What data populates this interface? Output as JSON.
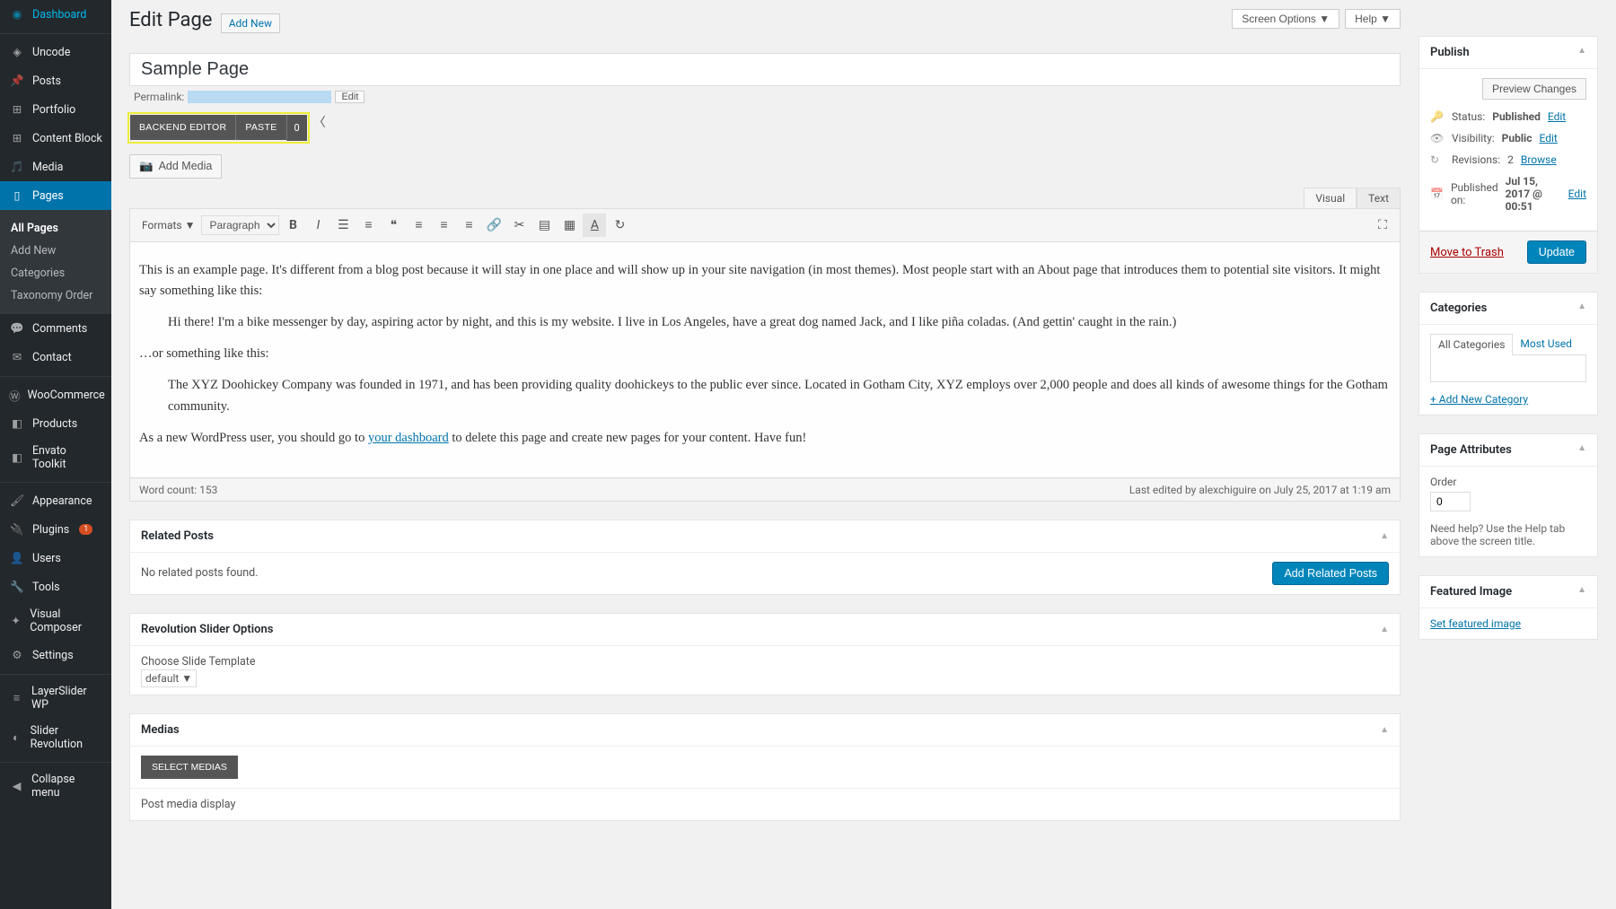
{
  "topbar": {
    "screen_options": "Screen Options ▼",
    "help": "Help ▼"
  },
  "header": {
    "title": "Edit Page",
    "add_new": "Add New"
  },
  "sidebar": {
    "items": [
      {
        "label": "Dashboard",
        "icon": "dashboard"
      },
      {
        "label": "Uncode",
        "icon": "diamond"
      },
      {
        "label": "Posts",
        "icon": "pin"
      },
      {
        "label": "Portfolio",
        "icon": "grid"
      },
      {
        "label": "Content Block",
        "icon": "grid"
      },
      {
        "label": "Media",
        "icon": "media"
      },
      {
        "label": "Pages",
        "icon": "page",
        "active": true
      },
      {
        "label": "Comments",
        "icon": "comment"
      },
      {
        "label": "Contact",
        "icon": "mail"
      },
      {
        "label": "WooCommerce",
        "icon": "woo"
      },
      {
        "label": "Products",
        "icon": "box"
      },
      {
        "label": "Envato Toolkit",
        "icon": "box"
      },
      {
        "label": "Appearance",
        "icon": "brush"
      },
      {
        "label": "Plugins",
        "icon": "plug",
        "badge": "1"
      },
      {
        "label": "Users",
        "icon": "user"
      },
      {
        "label": "Tools",
        "icon": "wrench"
      },
      {
        "label": "Visual Composer",
        "icon": "vc"
      },
      {
        "label": "Settings",
        "icon": "gear"
      },
      {
        "label": "LayerSlider WP",
        "icon": "layers"
      },
      {
        "label": "Slider Revolution",
        "icon": "slider"
      },
      {
        "label": "Collapse menu",
        "icon": "collapse"
      }
    ],
    "submenu": [
      "All Pages",
      "Add New",
      "Categories",
      "Taxonomy Order"
    ],
    "submenu_current": "All Pages"
  },
  "title_input": {
    "value": "Sample Page"
  },
  "permalink": {
    "label": "Permalink:",
    "edit": "Edit"
  },
  "editor_buttons": {
    "backend": "BACKEND EDITOR",
    "paste": "PASTE",
    "count": "0"
  },
  "add_media": "Add Media",
  "editor_tabs": {
    "visual": "Visual",
    "text": "Text"
  },
  "toolbar": {
    "formats": "Formats ▼",
    "paragraph": "Paragraph"
  },
  "content": {
    "p1": "This is an example page. It's different from a blog post because it will stay in one place and will show up in your site navigation (in most themes). Most people start with an About page that introduces them to potential site visitors. It might say something like this:",
    "bq1": "Hi there! I'm a bike messenger by day, aspiring actor by night, and this is my website. I live in Los Angeles, have a great dog named Jack, and I like piña coladas. (And gettin' caught in the rain.)",
    "p2": "…or something like this:",
    "bq2": "The XYZ Doohickey Company was founded in 1971, and has been providing quality doohickeys to the public ever since. Located in Gotham City, XYZ employs over 2,000 people and does all kinds of awesome things for the Gotham community.",
    "p3a": "As a new WordPress user, you should go to ",
    "p3link": "your dashboard",
    "p3b": " to delete this page and create new pages for your content. Have fun!"
  },
  "footer": {
    "wordcount": "Word count: 153",
    "lastedited": "Last edited by alexchiguire on July 25, 2017 at 1:19 am"
  },
  "related_posts": {
    "title": "Related Posts",
    "none": "No related posts found.",
    "add": "Add Related Posts"
  },
  "revslider": {
    "title": "Revolution Slider Options",
    "label": "Choose Slide Template",
    "value": "default ▼"
  },
  "medias": {
    "title": "Medias",
    "select": "SELECT MEDIAS",
    "display": "Post media display"
  },
  "publish": {
    "title": "Publish",
    "preview": "Preview Changes",
    "status_label": "Status:",
    "status": "Published",
    "visibility_label": "Visibility:",
    "visibility": "Public",
    "revisions_label": "Revisions:",
    "revisions": "2",
    "browse": "Browse",
    "published_label": "Published on:",
    "published": "Jul 15, 2017 @ 00:51",
    "edit": "Edit",
    "trash": "Move to Trash",
    "update": "Update"
  },
  "categories": {
    "title": "Categories",
    "all": "All Categories",
    "most": "Most Used",
    "add": "+ Add New Category"
  },
  "page_attr": {
    "title": "Page Attributes",
    "order_label": "Order",
    "order": "0",
    "help": "Need help? Use the Help tab above the screen title."
  },
  "featured": {
    "title": "Featured Image",
    "set": "Set featured image"
  }
}
